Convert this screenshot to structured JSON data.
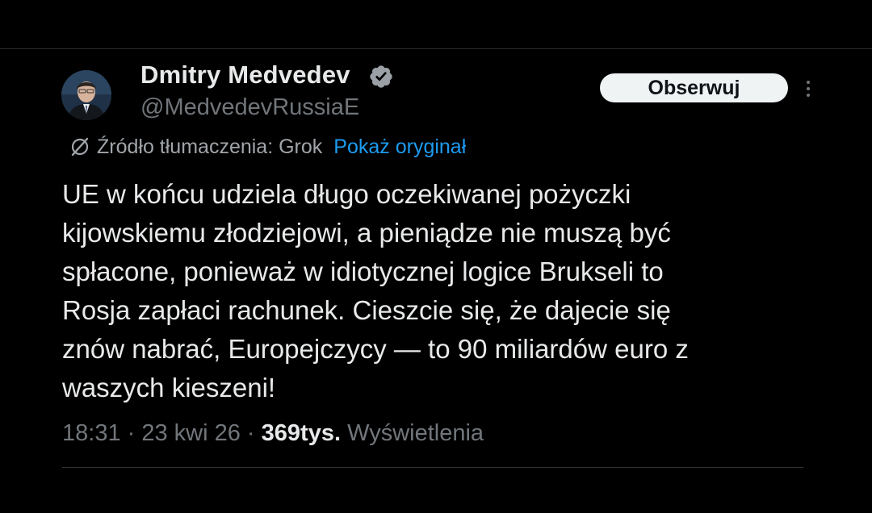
{
  "author": {
    "display_name": "Dmitry Medvedev",
    "handle": "@MedvedevRussiaE",
    "verified_icon": "verified-badge-icon"
  },
  "actions": {
    "follow_label": "Obserwuj",
    "more_icon": "more-vertical-icon"
  },
  "translation": {
    "icon": "grok-icon",
    "source_text": "Źródło tłumaczenia: Grok",
    "show_original_label": "Pokaż oryginał",
    "link_color": "#1d9bf0"
  },
  "tweet": {
    "text": "UE w końcu udziela długo oczekiwanej pożyczki\nkijowskiemu złodziejowi, a pieniądze nie muszą być\nspłacone, ponieważ w idiotycznej logice Brukseli to\nRosja zapłaci rachunek. Cieszcie się, że dajecie się\nznów nabrać, Europejczycy — to 90 miliardów euro z\nwaszych kieszeni!"
  },
  "meta": {
    "time": "18:31",
    "separator": " · ",
    "date": "23 kwi 26",
    "views_count": "369tys.",
    "views_label": "Wyświetlenia"
  },
  "colors": {
    "background": "#000000",
    "text_primary": "#e7e9ea",
    "text_secondary": "#71767b",
    "button_bg": "#eff3f4"
  }
}
